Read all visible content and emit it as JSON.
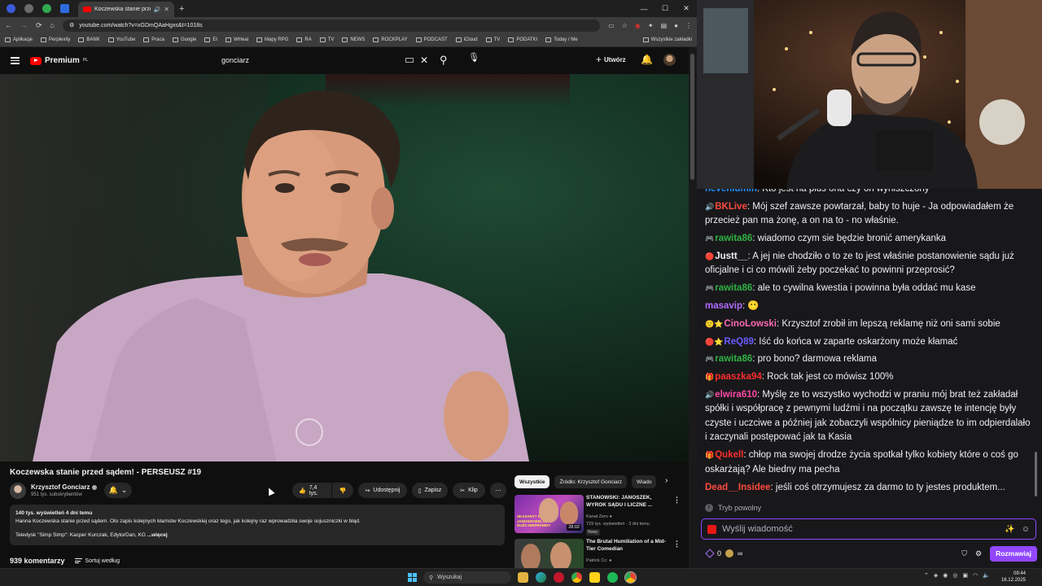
{
  "browser": {
    "tab_title": "Koczewska stanie przed sąd...",
    "url": "youtube.com/watch?v=xGDmQAaHgxs&t=1018s",
    "bookmarks": [
      "Aplikacje",
      "Perplexity",
      "BANK",
      "YouTube",
      "Praca",
      "Google",
      "EI",
      "WHeal",
      "Mapy RPG",
      "RA",
      "TV",
      "NEWS",
      "ROCKPLAY",
      "PODCAST",
      "iCloud",
      "TV",
      "PODATKI",
      "Today / Me"
    ],
    "all_bookmarks_label": "Wszystkie zakładki"
  },
  "youtube": {
    "logo_text": "Premium",
    "logo_country": "PL",
    "search_query": "gonciarz",
    "create_label": "Utwórz",
    "video_title": "Koczewska stanie przed sądem! - PERSEUSZ #19",
    "channel_name": "Krzysztof Gonciarz",
    "channel_subs": "951 tys. subskrybentów",
    "like_count": "7,4 tys.",
    "share_label": "Udostępnij",
    "save_label": "Zapisz",
    "clip_label": "Klip",
    "desc_stats": "140 tys. wyświetleń  4 dni temu",
    "desc_line1": "Hanna Koczewska stanie przed sądem. Oto zapis kolejnych kłamstw Koczewskiej oraz tego, jak kolejny raz wprowadziła swoje sojuszniczki w błąd.",
    "desc_line2_prefix": "Teledysk \"Simp Simp\": Kacper Kurczak, EdytorDan, KG ",
    "desc_more": "...więcej",
    "comments_count": "939 komentarzy",
    "sort_label": "Sortuj według",
    "chips": [
      "Wszystkie",
      "Źródło: Krzysztof Gonciarz",
      "Wiado"
    ],
    "recommendations": [
      {
        "title": "STANOWSKI: JANOSZEK, WYROK SĄDU I LICZNE ...",
        "channel": "Kanał Zero",
        "meta": "729 tys. wyświetleń · 3 dni temu",
        "badge": "Nowy",
        "duration": "28:02",
        "thumb_text": "SKAZANY? PROCES Z JANOSZKIEM, JEST DUŻO NIEPRAWDY"
      },
      {
        "title": "The Brutal Humiliation of a Mid-Tier Comedian",
        "channel": "Patrick Cc:",
        "meta": "",
        "badge": "",
        "duration": "",
        "thumb_text": ""
      }
    ]
  },
  "chat": {
    "messages": [
      {
        "user": "neveniumin",
        "color": "#1e90ff",
        "icons": "",
        "text": ": Kto jest na plus ona czy on wyniszczony"
      },
      {
        "user": "BKLive",
        "color": "#ff4a3d",
        "icons": "🔊",
        "text": ": Mój szef zawsze powtarzał, baby to huje - Ja odpowiadałem że przecież pan ma żonę, a on na to - no właśnie."
      },
      {
        "user": "rawita86",
        "color": "#2fb344",
        "icons": "🎮",
        "text": ": wiadomo czym sie będzie bronić amerykanka"
      },
      {
        "user": "Justt__",
        "color": "#efeff1",
        "icons": "🔴",
        "text": ": A jej nie chodziło o to ze to jest właśnie postanowienie sądu już oficjalne i ci co mówili żeby poczekać to powinni przeprosić?"
      },
      {
        "user": "rawita86",
        "color": "#2fb344",
        "icons": "🎮",
        "text": ": ale to cywilna kwestia i powinna była oddać mu kase"
      },
      {
        "user": "masavip",
        "color": "#b36bff",
        "icons": "",
        "text": ": 😶"
      },
      {
        "user": "CinoLowski",
        "color": "#ff69b4",
        "icons": "🙂⭐",
        "text": ": Krzysztof zrobił im lepszą reklamę niż oni sami sobie"
      },
      {
        "user": "ReQ89",
        "color": "#6a5cff",
        "icons": "🔴⭐",
        "text": ": Iść do końca w zaparte oskarżony może kłamać"
      },
      {
        "user": "rawita86",
        "color": "#2fb344",
        "icons": "🎮",
        "text": ": pro bono? darmowa reklama"
      },
      {
        "user": "paaszka94",
        "color": "#ff2d2d",
        "icons": "🎁",
        "text": ": Rock tak jest co mówisz 100%"
      },
      {
        "user": "elwira610",
        "color": "#ff4aa6",
        "icons": "🔊",
        "text": ": Myślę ze to wszystko wychodzi w praniu mój brat też zakładał spółki i współpracę z pewnymi ludźmi i na początku zawszę te intencję były czyste i uczciwe a później jak zobaczyli wspólnicy pieniądze to im odpierdalało i zaczynali postępować jak ta Kasia"
      },
      {
        "user": "Qukell",
        "color": "#ff2d2d",
        "icons": "🎁",
        "text": ": chłop ma swojej drodze życia spotkał tylko kobiety które o coś go oskarżają? Ale biedny ma pecha"
      },
      {
        "user": "Dead__Insidee",
        "color": "#ff4a3d",
        "icons": "",
        "text": ": jeśli coś otrzymujesz za darmo to ty jestes produktem..."
      }
    ],
    "slow_mode": "Tryb powolny",
    "placeholder": "Wyślij wiadomość",
    "points": "0",
    "inf": "∞",
    "send_label": "Rozmawiaj"
  },
  "taskbar": {
    "search": "Wyszukaj",
    "time": "09:44",
    "date": "16.12.2025"
  }
}
